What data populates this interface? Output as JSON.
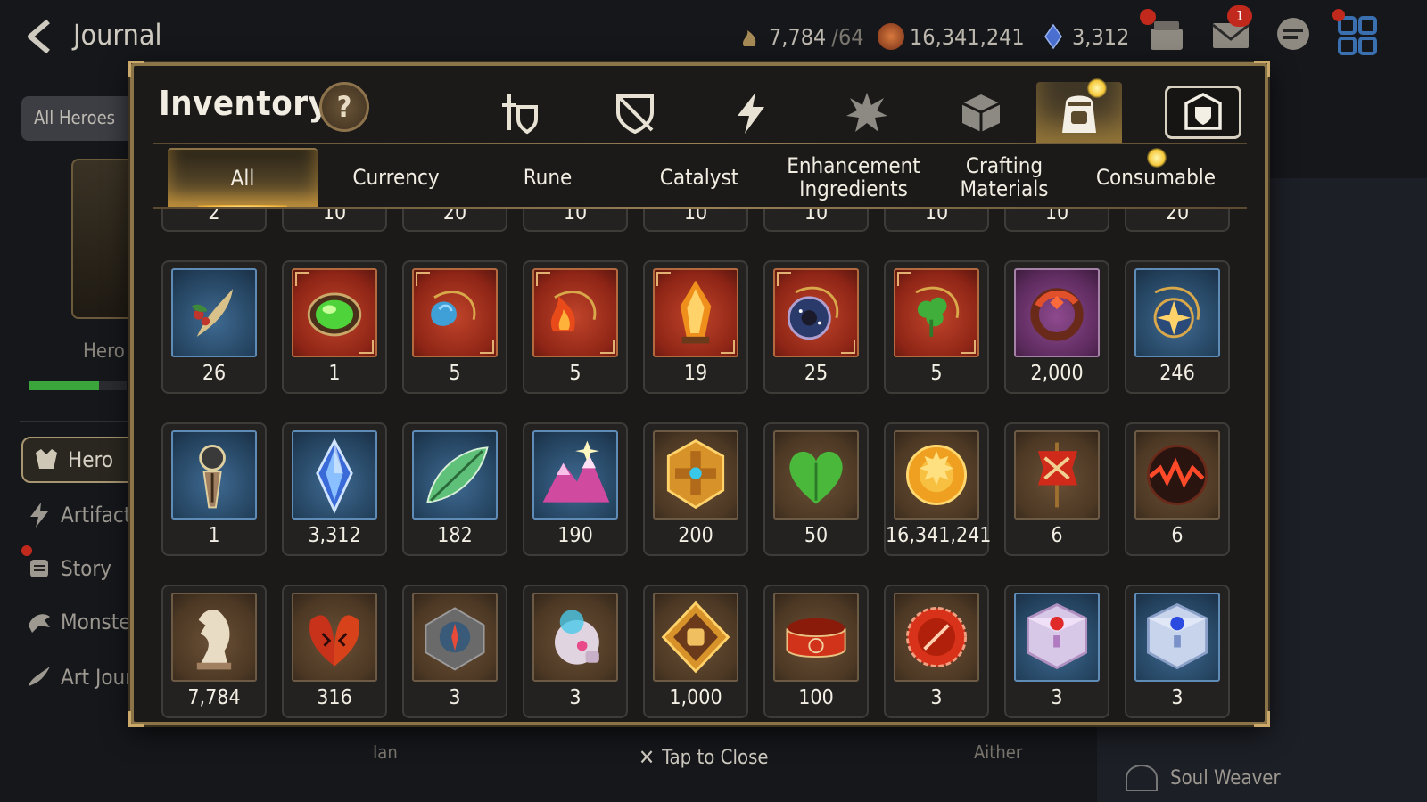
{
  "journal": {
    "title": "Journal",
    "resources": [
      {
        "name": "stamina",
        "value": "7,784",
        "cap": "/64",
        "color": "#a78b56"
      },
      {
        "name": "gold",
        "value": "16,341,241",
        "color": "#b0532a"
      },
      {
        "name": "skystone",
        "value": "3,312",
        "color": "#4a6fd0"
      }
    ],
    "mail_badge": "1",
    "filter_label": "All Heroes",
    "hero_label": "Hero",
    "nav": [
      {
        "label": "Hero",
        "icon": "hero-icon"
      },
      {
        "label": "Artifact",
        "icon": "lightning-icon"
      },
      {
        "label": "Story",
        "icon": "scroll-icon"
      },
      {
        "label": "Monster",
        "icon": "monster-icon"
      },
      {
        "label": "Art Journal",
        "icon": "brush-icon"
      }
    ],
    "bottom_labels": [
      "Ian",
      "Aither"
    ],
    "soul_weaver": "Soul Weaver"
  },
  "inventory": {
    "title": "Inventory",
    "help": "?",
    "categories": [
      {
        "icon": "hero-equipment-icon"
      },
      {
        "icon": "broken-shield-icon"
      },
      {
        "icon": "lightning-icon"
      },
      {
        "icon": "burst-icon"
      },
      {
        "icon": "cube-icon"
      },
      {
        "icon": "backpack-icon",
        "selected": true
      },
      {
        "icon": "guild-shield-icon"
      }
    ],
    "tabs": [
      {
        "label": "All",
        "selected": true
      },
      {
        "label": "Currency"
      },
      {
        "label": "Rune"
      },
      {
        "label": "Catalyst"
      },
      {
        "label": "Enhancement\nIngredients"
      },
      {
        "label": "Crafting\nMaterials"
      },
      {
        "label": "Consumable"
      }
    ],
    "partial_row": [
      "2",
      "10",
      "20",
      "10",
      "10",
      "10",
      "10",
      "10",
      "20"
    ],
    "rows": [
      [
        {
          "qty": "26",
          "bg": "blue",
          "icon": "herb-icon"
        },
        {
          "qty": "1",
          "bg": "red",
          "icon": "green-gem-icon"
        },
        {
          "qty": "5",
          "bg": "red",
          "icon": "blue-pendant-icon"
        },
        {
          "qty": "5",
          "bg": "red",
          "icon": "flame-pendant-icon"
        },
        {
          "qty": "19",
          "bg": "red",
          "icon": "flame-crystal-icon"
        },
        {
          "qty": "25",
          "bg": "red",
          "icon": "starry-pendant-icon"
        },
        {
          "qty": "5",
          "bg": "red",
          "icon": "clover-pendant-icon"
        },
        {
          "qty": "2,000",
          "bg": "purple",
          "icon": "red-ring-icon"
        },
        {
          "qty": "246",
          "bg": "blue",
          "icon": "star-pendant-icon"
        }
      ],
      [
        {
          "qty": "1",
          "bg": "blue",
          "icon": "compass-charm-icon"
        },
        {
          "qty": "3,312",
          "bg": "blue",
          "icon": "skystone-icon"
        },
        {
          "qty": "182",
          "bg": "blue",
          "icon": "leaf-icon"
        },
        {
          "qty": "190",
          "bg": "blue",
          "icon": "crystal-mountain-icon"
        },
        {
          "qty": "200",
          "bg": "brown",
          "icon": "hexagon-medal-icon"
        },
        {
          "qty": "50",
          "bg": "brown",
          "icon": "green-heart-icon"
        },
        {
          "qty": "16,341,241",
          "bg": "brown",
          "icon": "gold-coin-icon"
        },
        {
          "qty": "6",
          "bg": "brown",
          "icon": "red-banner-icon"
        },
        {
          "qty": "6",
          "bg": "brown",
          "icon": "dark-orb-icon"
        }
      ],
      [
        {
          "qty": "7,784",
          "bg": "brown",
          "icon": "knight-piece-icon"
        },
        {
          "qty": "316",
          "bg": "brown",
          "icon": "red-leaf-icon"
        },
        {
          "qty": "3",
          "bg": "brown",
          "icon": "stone-compass-icon"
        },
        {
          "qty": "3",
          "bg": "brown",
          "icon": "robot-pet-icon"
        },
        {
          "qty": "1,000",
          "bg": "brown",
          "icon": "fist-badge-icon"
        },
        {
          "qty": "100",
          "bg": "brown",
          "icon": "red-band-icon"
        },
        {
          "qty": "3",
          "bg": "brown",
          "icon": "red-seal-icon"
        },
        {
          "qty": "3",
          "bg": "blue",
          "icon": "ruby-chest-icon"
        },
        {
          "qty": "3",
          "bg": "blue",
          "icon": "sapphire-chest-icon"
        }
      ]
    ],
    "close_label": "Tap to Close"
  }
}
